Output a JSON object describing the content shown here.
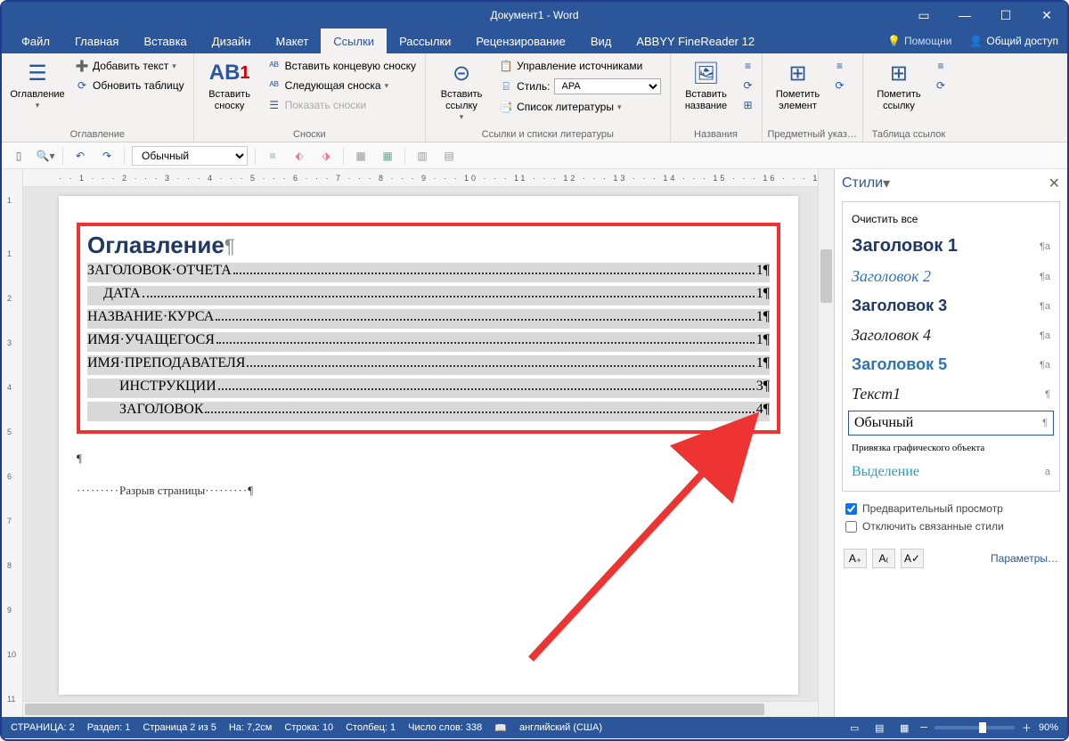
{
  "title": "Документ1 - Word",
  "tabs": [
    "Файл",
    "Главная",
    "Вставка",
    "Дизайн",
    "Макет",
    "Ссылки",
    "Рассылки",
    "Рецензирование",
    "Вид",
    "ABBYY FineReader 12"
  ],
  "active_tab": "Ссылки",
  "helper": "Помощни",
  "share": "Общий доступ",
  "ribbon": {
    "g1": {
      "label": "Оглавление",
      "btn": "Оглавление",
      "add_text": "Добавить текст",
      "update": "Обновить таблицу"
    },
    "g2": {
      "label": "Сноски",
      "btn": "Вставить\nсноску",
      "ab": "АВ",
      "end": "Вставить концевую сноску",
      "next": "Следующая сноска",
      "show": "Показать сноски"
    },
    "g3": {
      "label": "Ссылки и списки литературы",
      "btn": "Вставить\nссылку",
      "manage": "Управление источниками",
      "style_label": "Стиль:",
      "style_value": "APA",
      "biblio": "Список литературы"
    },
    "g4": {
      "label": "Названия",
      "btn": "Вставить\nназвание"
    },
    "g5": {
      "label": "Предметный указ…",
      "btn": "Пометить\nэлемент"
    },
    "g6": {
      "label": "Таблица ссылок",
      "btn": "Пометить\nссылку"
    }
  },
  "toolbar2": {
    "style": "Обычный"
  },
  "ruler_h": "· · 1 · · · 2 · · · 3 · · · 4 · · · 5 · · · 6 · · · 7 · · · 8 · · · 9 · · · 10 · · · 11 · · · 12 · · · 13 · · · 14 · · · 15 · · · 16 · · · 17 · · · 18 · · · 19",
  "ruler_v": [
    "1",
    "",
    "1",
    "2",
    "3",
    "4",
    "5",
    "6",
    "7",
    "8",
    "9",
    "10",
    "11"
  ],
  "doc": {
    "toc_title": "Оглавление",
    "entries": [
      {
        "text": "ЗАГОЛОВОК·ОТЧЕТА",
        "page": "1",
        "indent": 0
      },
      {
        "text": "ДАТА",
        "page": "1",
        "indent": 1
      },
      {
        "text": "НАЗВАНИЕ·КУРСА",
        "page": "1",
        "indent": 0
      },
      {
        "text": "ИМЯ·УЧАЩЕГОСЯ",
        "page": "1",
        "indent": 0
      },
      {
        "text": "ИМЯ·ПРЕПОДАВАТЕЛЯ",
        "page": "1",
        "indent": 0
      },
      {
        "text": "ИНСТРУКЦИИ",
        "page": "3",
        "indent": 2
      },
      {
        "text": "ЗАГОЛОВОК",
        "page": "4",
        "indent": 2
      }
    ],
    "pagebreak": "Разрыв страницы"
  },
  "styles": {
    "title": "Стили",
    "clear": "Очистить все",
    "items": [
      {
        "cls": "h1",
        "label": "Заголовок 1",
        "mark": "¶a"
      },
      {
        "cls": "h2",
        "label": "Заголовок 2",
        "mark": "¶a"
      },
      {
        "cls": "h3",
        "label": "Заголовок 3",
        "mark": "¶a"
      },
      {
        "cls": "h4",
        "label": "Заголовок 4",
        "mark": "¶a"
      },
      {
        "cls": "h5",
        "label": "Заголовок 5",
        "mark": "¶a"
      },
      {
        "cls": "t1",
        "label": "Текст1",
        "mark": "¶"
      },
      {
        "cls": "normal",
        "label": "Обычный",
        "mark": "¶"
      },
      {
        "cls": "anchor",
        "label": "Привязка графического объекта",
        "mark": ""
      },
      {
        "cls": "sel",
        "label": "Выделение",
        "mark": "a"
      }
    ],
    "preview": "Предварительный просмотр",
    "disable": "Отключить связанные стили",
    "params": "Параметры…"
  },
  "status": {
    "page": "СТРАНИЦА: 2",
    "section": "Раздел: 1",
    "pages": "Страница 2 из 5",
    "at": "На: 7,2см",
    "line": "Строка: 10",
    "col": "Столбец: 1",
    "words": "Число слов: 338",
    "lang": "английский (США)",
    "zoom": "90%"
  }
}
